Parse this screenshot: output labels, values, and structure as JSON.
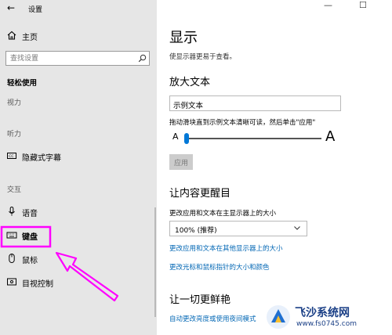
{
  "window": {
    "title": "设置",
    "back_glyph": "←",
    "minimize_glyph": "—",
    "maximize_glyph": "☐"
  },
  "sidebar": {
    "home_label": "主页",
    "search_placeholder": "查找设置",
    "section_title": "轻松使用",
    "groups": [
      {
        "header": "视力"
      },
      {
        "header": "听力",
        "items": [
          {
            "label": "隐藏式字幕",
            "icon": "closed-captions-icon"
          }
        ]
      },
      {
        "header": "交互",
        "items": [
          {
            "label": "语音",
            "icon": "microphone-icon"
          },
          {
            "label": "键盘",
            "icon": "keyboard-icon",
            "highlighted": true
          },
          {
            "label": "鼠标",
            "icon": "mouse-icon"
          },
          {
            "label": "目视控制",
            "icon": "eye-control-icon"
          }
        ]
      }
    ]
  },
  "main": {
    "title": "显示",
    "subtitle": "使显示器更易于查看。",
    "enlarge_text": {
      "heading": "放大文本",
      "sample_text": "示例文本",
      "instructions": "拖动滑块直到示例文本清晰可读，然后单击\"应用\"",
      "small_a": "A",
      "large_a": "A",
      "slider_value_fraction": 0.0,
      "apply_label": "应用"
    },
    "make_bigger": {
      "heading": "让内容更醒目",
      "size_label": "更改应用和文本在主显示器上的大小",
      "size_value": "100% (推荐)",
      "link_other_displays": "更改应用和文本在其他显示器上的大小",
      "link_pointer": "更改光标和鼠标指针的大小和颜色"
    },
    "brighter": {
      "heading": "让一切更鲜艳",
      "link_brightness": "自动更改亮度或使用夜间模式"
    }
  },
  "watermark": {
    "brand": "飞沙系统网",
    "url": "www.fs0745.com"
  },
  "colors": {
    "annotation": "#ff00ff",
    "accent": "#0078d7",
    "link": "#0066b4"
  }
}
